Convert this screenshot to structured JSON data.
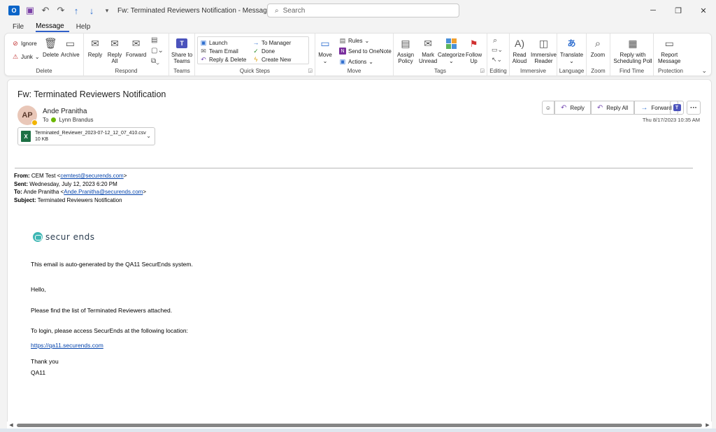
{
  "window": {
    "title": "Fw: Terminated Reviewers Notification  -  Message (HTML)",
    "search_placeholder": "Search"
  },
  "menu": {
    "tabs": [
      "File",
      "Message",
      "Help"
    ],
    "active_tab": "Message"
  },
  "ribbon": {
    "delete": {
      "ignore": "Ignore",
      "junk": "Junk",
      "delete": "Delete",
      "archive": "Archive",
      "label": "Delete"
    },
    "respond": {
      "reply": "Reply",
      "reply_all_1": "Reply",
      "reply_all_2": "All",
      "forward": "Forward",
      "label": "Respond"
    },
    "teams": {
      "share_1": "Share to",
      "share_2": "Teams",
      "label": "Teams"
    },
    "quick_steps": {
      "launch": "Launch",
      "to_manager": "To Manager",
      "team_email": "Team Email",
      "done": "Done",
      "reply_delete": "Reply & Delete",
      "create_new": "Create New",
      "label": "Quick Steps"
    },
    "move": {
      "move": "Move",
      "rules": "Rules",
      "send_onenote": "Send to OneNote",
      "actions": "Actions",
      "label": "Move"
    },
    "tags": {
      "assign_1": "Assign",
      "assign_2": "Policy",
      "mark_1": "Mark",
      "mark_2": "Unread",
      "categorize": "Categorize",
      "follow_1": "Follow",
      "follow_2": "Up",
      "label": "Tags"
    },
    "editing": {
      "label": "Editing"
    },
    "immersive": {
      "read_1": "Read",
      "read_2": "Aloud",
      "imm_1": "Immersive",
      "imm_2": "Reader",
      "label": "Immersive"
    },
    "language": {
      "translate": "Translate",
      "label": "Language"
    },
    "zoom": {
      "zoom": "Zoom",
      "label": "Zoom"
    },
    "find_time": {
      "poll_1": "Reply with",
      "poll_2": "Scheduling Poll",
      "label": "Find Time"
    },
    "protection": {
      "report_1": "Report",
      "report_2": "Message",
      "label": "Protection"
    }
  },
  "message": {
    "subject": "Fw: Terminated Reviewers Notification",
    "avatar_initials": "AP",
    "sender": "Ande Pranitha",
    "to_label": "To",
    "to_name": "Lynn Brandus",
    "attachment_name": "Terminated_Reviewer_2023-07-12_12_07_410.csv",
    "attachment_size": "10 KB",
    "actions": {
      "reply": "Reply",
      "reply_all": "Reply All",
      "forward": "Forward"
    },
    "date": "Thu 8/17/2023 10:35 AM"
  },
  "forward_headers": {
    "from_label": "From:",
    "from_name": "CEM Test <",
    "from_email": "cemtest@securends.com",
    "from_end": ">",
    "sent_label": "Sent:",
    "sent_value": "Wednesday, July 12, 2023 6:20 PM",
    "to_label": "To:",
    "to_name": "Ande Pranitha <",
    "to_email": "Ande.Pranitha@securends.com",
    "to_end": ">",
    "subject_label": "Subject:",
    "subject_value": "Terminated Reviewers Notification"
  },
  "body": {
    "logo_text": "secur ends",
    "auto_generated": "This email is auto-generated by the QA11 SecurEnds system.",
    "hello": "Hello,",
    "find_list": "Please find the list of Terminated Reviewers attached.",
    "login_text": "To login, please access SecurEnds at the following location:",
    "login_link": "https://qa11.securends.com",
    "thank_you": "Thank you",
    "signature": "QA11"
  }
}
